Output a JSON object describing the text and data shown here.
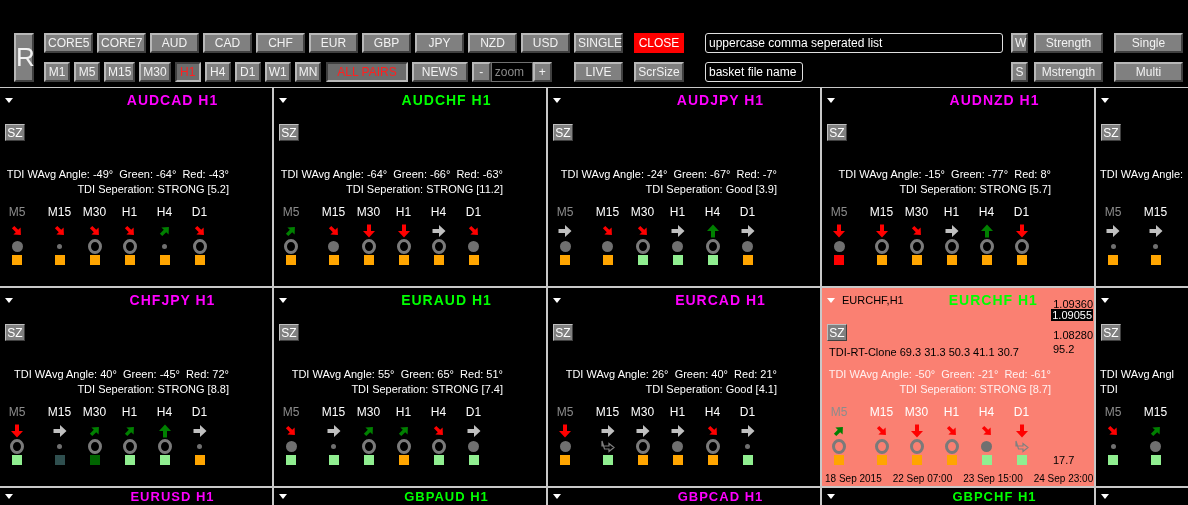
{
  "toolbar": {
    "reset": "R",
    "rows": [
      {
        "left": [
          {
            "kind": "button",
            "label": "CORE5"
          },
          {
            "kind": "button",
            "label": "CORE7"
          },
          {
            "kind": "button",
            "label": "AUD"
          },
          {
            "kind": "button",
            "label": "CAD"
          },
          {
            "kind": "button",
            "label": "CHF"
          },
          {
            "kind": "button",
            "label": "EUR"
          },
          {
            "kind": "button",
            "label": "GBP"
          },
          {
            "kind": "button",
            "label": "JPY"
          },
          {
            "kind": "button",
            "label": "NZD"
          },
          {
            "kind": "button",
            "label": "USD"
          }
        ],
        "right": [
          {
            "kind": "button",
            "label": "SINGLE"
          },
          {
            "kind": "danger",
            "label": "CLOSE"
          },
          {
            "kind": "field",
            "value": "uppercase comma seperated list"
          },
          {
            "kind": "button",
            "label": "W"
          },
          {
            "kind": "button",
            "label": "Strength"
          },
          {
            "kind": "button",
            "label": "Single"
          }
        ]
      },
      {
        "left": [
          {
            "kind": "toggle",
            "label": "M1",
            "selected": false
          },
          {
            "kind": "toggle",
            "label": "M5",
            "selected": false
          },
          {
            "kind": "toggle",
            "label": "M15",
            "selected": false
          },
          {
            "kind": "toggle",
            "label": "M30",
            "selected": false
          },
          {
            "kind": "toggle",
            "label": "H1",
            "selected": true
          },
          {
            "kind": "toggle",
            "label": "H4",
            "selected": false
          },
          {
            "kind": "toggle",
            "label": "D1",
            "selected": false
          },
          {
            "kind": "toggle",
            "label": "W1",
            "selected": false
          },
          {
            "kind": "toggle",
            "label": "MN",
            "selected": false
          },
          {
            "kind": "toggle",
            "label": "ALL PAIRS",
            "selected": true
          },
          {
            "kind": "button",
            "label": "NEWS"
          },
          {
            "kind": "button",
            "label": "-"
          },
          {
            "kind": "field",
            "placeholder": "zoom"
          },
          {
            "kind": "button",
            "label": "+"
          }
        ],
        "right": [
          {
            "kind": "button",
            "label": "LIVE"
          },
          {
            "kind": "button",
            "label": "ScrSize"
          },
          {
            "kind": "field",
            "value": "basket file name"
          },
          {
            "kind": "button",
            "label": "S"
          },
          {
            "kind": "button",
            "label": "Mstrength"
          },
          {
            "kind": "button",
            "label": "Multi"
          }
        ]
      }
    ]
  },
  "panels": [
    {
      "kind": "monitor",
      "title": "AUDCAD H1",
      "color": "#ff00ff",
      "button": "SZ",
      "lines": [
        "TDI WAvg Angle: -49°  Green: -64°  Red: -43°",
        "TDI Seperation: STRONG [5.2]"
      ],
      "columns": [
        {
          "label": "M5",
          "disabled": true,
          "arrow": {
            "kind": "down_right",
            "color": "#ff0000"
          },
          "mark": {
            "kind": "dot"
          },
          "square": {
            "color": "#ffa500"
          }
        },
        {
          "label": "M15",
          "disabled": false,
          "arrow": {
            "kind": "down_right",
            "color": "#ff0000"
          },
          "mark": {
            "kind": "small_dot"
          },
          "square": {
            "color": "#ffa500"
          }
        },
        {
          "label": "M30",
          "disabled": false,
          "arrow": {
            "kind": "down_right",
            "color": "#ff0000"
          },
          "mark": {
            "kind": "ring"
          },
          "square": {
            "color": "#ffa500"
          }
        },
        {
          "label": "H1",
          "disabled": false,
          "arrow": {
            "kind": "down_right",
            "color": "#ff0000"
          },
          "mark": {
            "kind": "ring"
          },
          "square": {
            "color": "#ffa500"
          }
        },
        {
          "label": "H4",
          "disabled": false,
          "arrow": {
            "kind": "up_right",
            "color": "#008000"
          },
          "mark": {
            "kind": "small_dot"
          },
          "square": {
            "color": "#ffa500"
          }
        },
        {
          "label": "D1",
          "disabled": false,
          "arrow": {
            "kind": "down_right",
            "color": "#ff0000"
          },
          "mark": {
            "kind": "ring"
          },
          "square": {
            "color": "#ffa500"
          }
        }
      ]
    },
    {
      "kind": "monitor",
      "title": "AUDCHF H1",
      "color": "#00ff00",
      "button": "SZ",
      "lines": [
        "TDI WAvg Angle: -64°  Green: -66°  Red: -63°",
        "TDI Seperation: STRONG [11.2]"
      ],
      "columns": [
        {
          "label": "M5",
          "disabled": true,
          "arrow": {
            "kind": "up_right",
            "color": "#008000"
          },
          "mark": {
            "kind": "ring"
          },
          "square": {
            "color": "#ffa500"
          }
        },
        {
          "label": "M15",
          "disabled": false,
          "arrow": {
            "kind": "down_right",
            "color": "#ff0000"
          },
          "mark": {
            "kind": "dot"
          },
          "square": {
            "color": "#ffa500"
          }
        },
        {
          "label": "M30",
          "disabled": false,
          "arrow": {
            "kind": "down",
            "color": "#ff0000"
          },
          "mark": {
            "kind": "ring"
          },
          "square": {
            "color": "#ffa500"
          }
        },
        {
          "label": "H1",
          "disabled": false,
          "arrow": {
            "kind": "down",
            "color": "#ff0000"
          },
          "mark": {
            "kind": "ring"
          },
          "square": {
            "color": "#ffa500"
          }
        },
        {
          "label": "H4",
          "disabled": false,
          "arrow": {
            "kind": "right",
            "color": "#c0c0c0"
          },
          "mark": {
            "kind": "ring"
          },
          "square": {
            "color": "#ffa500"
          }
        },
        {
          "label": "D1",
          "disabled": false,
          "arrow": {
            "kind": "down_right",
            "color": "#ff0000"
          },
          "mark": {
            "kind": "dot"
          },
          "square": {
            "color": "#ffa500"
          }
        }
      ]
    },
    {
      "kind": "monitor",
      "title": "AUDJPY H1",
      "color": "#ff00ff",
      "button": "SZ",
      "lines": [
        "TDI WAvg Angle: -24°  Green: -67°  Red: -7°",
        "TDI Seperation: Good [3.9]"
      ],
      "columns": [
        {
          "label": "M5",
          "disabled": true,
          "arrow": {
            "kind": "right",
            "color": "#c0c0c0"
          },
          "mark": {
            "kind": "dot"
          },
          "square": {
            "color": "#ffa500"
          }
        },
        {
          "label": "M15",
          "disabled": false,
          "arrow": {
            "kind": "down_right",
            "color": "#ff0000"
          },
          "mark": {
            "kind": "dot"
          },
          "square": {
            "color": "#ffa500"
          }
        },
        {
          "label": "M30",
          "disabled": false,
          "arrow": {
            "kind": "down_right",
            "color": "#ff0000"
          },
          "mark": {
            "kind": "ring"
          },
          "square": {
            "color": "#90ee90"
          }
        },
        {
          "label": "H1",
          "disabled": false,
          "arrow": {
            "kind": "right",
            "color": "#c0c0c0"
          },
          "mark": {
            "kind": "dot"
          },
          "square": {
            "color": "#90ee90"
          }
        },
        {
          "label": "H4",
          "disabled": false,
          "arrow": {
            "kind": "up",
            "color": "#008000"
          },
          "mark": {
            "kind": "ring"
          },
          "square": {
            "color": "#90ee90"
          }
        },
        {
          "label": "D1",
          "disabled": false,
          "arrow": {
            "kind": "right",
            "color": "#c0c0c0"
          },
          "mark": {
            "kind": "dot"
          },
          "square": {
            "color": "#ffa500"
          }
        }
      ]
    },
    {
      "kind": "monitor",
      "title": "AUDNZD H1",
      "color": "#ff00ff",
      "button": "SZ",
      "lines": [
        "TDI WAvg Angle: -15°  Green: -77°  Red: 8°",
        "TDI Seperation: STRONG [5.7]"
      ],
      "columns": [
        {
          "label": "M5",
          "disabled": true,
          "arrow": {
            "kind": "down",
            "color": "#ff0000"
          },
          "mark": {
            "kind": "dot"
          },
          "square": {
            "color": "#ff0000"
          }
        },
        {
          "label": "M15",
          "disabled": false,
          "arrow": {
            "kind": "down",
            "color": "#ff0000"
          },
          "mark": {
            "kind": "ring"
          },
          "square": {
            "color": "#ffa500"
          }
        },
        {
          "label": "M30",
          "disabled": false,
          "arrow": {
            "kind": "down_right",
            "color": "#ff0000"
          },
          "mark": {
            "kind": "ring"
          },
          "square": {
            "color": "#ffa500"
          }
        },
        {
          "label": "H1",
          "disabled": false,
          "arrow": {
            "kind": "right",
            "color": "#c0c0c0"
          },
          "mark": {
            "kind": "ring"
          },
          "square": {
            "color": "#ffa500"
          }
        },
        {
          "label": "H4",
          "disabled": false,
          "arrow": {
            "kind": "up",
            "color": "#008000"
          },
          "mark": {
            "kind": "ring"
          },
          "square": {
            "color": "#ffa500"
          }
        },
        {
          "label": "D1",
          "disabled": false,
          "arrow": {
            "kind": "down",
            "color": "#ff0000"
          },
          "mark": {
            "kind": "ring"
          },
          "square": {
            "color": "#ffa500"
          }
        }
      ]
    },
    {
      "kind": "partial",
      "button": "SZ",
      "lines": [
        "TDI WAvg Angle:"
      ],
      "columns": [
        {
          "label": "M5",
          "disabled": true,
          "arrow": {
            "kind": "right",
            "color": "#c0c0c0"
          },
          "mark": {
            "kind": "small_dot"
          },
          "square": {
            "color": "#ffa500"
          }
        },
        {
          "label": "M15",
          "disabled": false,
          "arrow": {
            "kind": "right",
            "color": "#c0c0c0"
          },
          "mark": {
            "kind": "small_dot"
          },
          "square": {
            "color": "#ffa500"
          }
        }
      ]
    },
    {
      "kind": "monitor",
      "title": "CHFJPY H1",
      "color": "#ff00ff",
      "button": "SZ",
      "lines": [
        "TDI WAvg Angle: 40°  Green: -45°  Red: 72°",
        "TDI Seperation: STRONG [8.8]"
      ],
      "columns": [
        {
          "label": "M5",
          "disabled": true,
          "arrow": {
            "kind": "down",
            "color": "#ff0000"
          },
          "mark": {
            "kind": "ring"
          },
          "square": {
            "color": "#90ee90"
          }
        },
        {
          "label": "M15",
          "disabled": false,
          "arrow": {
            "kind": "right",
            "color": "#c0c0c0"
          },
          "mark": {
            "kind": "small_dot"
          },
          "square": {
            "color": "#2f4f4f"
          }
        },
        {
          "label": "M30",
          "disabled": false,
          "arrow": {
            "kind": "up_right",
            "color": "#008000"
          },
          "mark": {
            "kind": "ring"
          },
          "square": {
            "color": "#006400"
          }
        },
        {
          "label": "H1",
          "disabled": false,
          "arrow": {
            "kind": "up_right",
            "color": "#008000"
          },
          "mark": {
            "kind": "ring"
          },
          "square": {
            "color": "#90ee90"
          }
        },
        {
          "label": "H4",
          "disabled": false,
          "arrow": {
            "kind": "up",
            "color": "#008000"
          },
          "mark": {
            "kind": "ring"
          },
          "square": {
            "color": "#90ee90"
          }
        },
        {
          "label": "D1",
          "disabled": false,
          "arrow": {
            "kind": "right",
            "color": "#c0c0c0"
          },
          "mark": {
            "kind": "small_dot"
          },
          "square": {
            "color": "#ffa500"
          }
        }
      ]
    },
    {
      "kind": "monitor",
      "title": "EURAUD H1",
      "color": "#00ff00",
      "button": "SZ",
      "lines": [
        "TDI WAvg Angle: 55°  Green: 65°  Red: 51°",
        "TDI Seperation: STRONG [7.4]"
      ],
      "columns": [
        {
          "label": "M5",
          "disabled": true,
          "arrow": {
            "kind": "down_right",
            "color": "#ff0000"
          },
          "mark": {
            "kind": "dot"
          },
          "square": {
            "color": "#90ee90"
          }
        },
        {
          "label": "M15",
          "disabled": false,
          "arrow": {
            "kind": "right",
            "color": "#c0c0c0"
          },
          "mark": {
            "kind": "small_dot"
          },
          "square": {
            "color": "#90ee90"
          }
        },
        {
          "label": "M30",
          "disabled": false,
          "arrow": {
            "kind": "up_right",
            "color": "#008000"
          },
          "mark": {
            "kind": "ring"
          },
          "square": {
            "color": "#90ee90"
          }
        },
        {
          "label": "H1",
          "disabled": false,
          "arrow": {
            "kind": "up_right",
            "color": "#008000"
          },
          "mark": {
            "kind": "ring"
          },
          "square": {
            "color": "#ffa500"
          }
        },
        {
          "label": "H4",
          "disabled": false,
          "arrow": {
            "kind": "down_right",
            "color": "#ff0000"
          },
          "mark": {
            "kind": "ring"
          },
          "square": {
            "color": "#90ee90"
          }
        },
        {
          "label": "D1",
          "disabled": false,
          "arrow": {
            "kind": "right",
            "color": "#c0c0c0"
          },
          "mark": {
            "kind": "dot"
          },
          "square": {
            "color": "#90ee90"
          }
        }
      ]
    },
    {
      "kind": "monitor",
      "title": "EURCAD H1",
      "color": "#ff00ff",
      "button": "SZ",
      "lines": [
        "TDI WAvg Angle: 26°  Green: 40°  Red: 21°",
        "TDI Seperation: Good [4.1]"
      ],
      "columns": [
        {
          "label": "M5",
          "disabled": true,
          "arrow": {
            "kind": "down",
            "color": "#ff0000"
          },
          "mark": {
            "kind": "dot"
          },
          "square": {
            "color": "#ffa500"
          }
        },
        {
          "label": "M15",
          "disabled": false,
          "arrow": {
            "kind": "right",
            "color": "#c0c0c0"
          },
          "mark": {
            "kind": "hook"
          },
          "square": {
            "color": "#90ee90"
          }
        },
        {
          "label": "M30",
          "disabled": false,
          "arrow": {
            "kind": "right",
            "color": "#c0c0c0"
          },
          "mark": {
            "kind": "ring"
          },
          "square": {
            "color": "#ffa500"
          }
        },
        {
          "label": "H1",
          "disabled": false,
          "arrow": {
            "kind": "right",
            "color": "#c0c0c0"
          },
          "mark": {
            "kind": "dot"
          },
          "square": {
            "color": "#ffa500"
          }
        },
        {
          "label": "H4",
          "disabled": false,
          "arrow": {
            "kind": "down_right",
            "color": "#ff0000"
          },
          "mark": {
            "kind": "ring"
          },
          "square": {
            "color": "#ffa500"
          }
        },
        {
          "label": "D1",
          "disabled": false,
          "arrow": {
            "kind": "right",
            "color": "#c0c0c0"
          },
          "mark": {
            "kind": "small_dot"
          },
          "square": {
            "color": "#90ee90"
          }
        }
      ]
    },
    {
      "kind": "chart",
      "symbol": "EURCHF,H1",
      "title": "EURCHF H1",
      "color": "#00ff00",
      "button": "SZ",
      "price_high": "1.09360",
      "price_current": "1.09055",
      "price_low": "1.08280",
      "indicator": "TDI-RT-Clone 69.3 31.3 50.3 41.1 30.7",
      "indicator_high": "95.2",
      "indicator_low": "17.7",
      "dates": [
        "18 Sep 2015",
        "22 Sep 07:00",
        "23 Sep 15:00",
        "24 Sep 23:00"
      ],
      "lines": [
        "TDI WAvg Angle: -50°  Green: -21°  Red: -61°",
        "TDI Seperation: STRONG [8.7]"
      ],
      "columns": [
        {
          "label": "M5",
          "disabled": true,
          "arrow": {
            "kind": "up_right",
            "color": "#008000"
          },
          "mark": {
            "kind": "ring"
          },
          "square": {
            "color": "#ffa500"
          }
        },
        {
          "label": "M15",
          "disabled": false,
          "arrow": {
            "kind": "down_right",
            "color": "#ff0000"
          },
          "mark": {
            "kind": "ring"
          },
          "square": {
            "color": "#ffa500"
          }
        },
        {
          "label": "M30",
          "disabled": false,
          "arrow": {
            "kind": "down",
            "color": "#ff0000"
          },
          "mark": {
            "kind": "ring"
          },
          "square": {
            "color": "#ffa500"
          }
        },
        {
          "label": "H1",
          "disabled": false,
          "arrow": {
            "kind": "down_right",
            "color": "#ff0000"
          },
          "mark": {
            "kind": "ring"
          },
          "square": {
            "color": "#ffa500"
          }
        },
        {
          "label": "H4",
          "disabled": false,
          "arrow": {
            "kind": "down_right",
            "color": "#ff0000"
          },
          "mark": {
            "kind": "dot"
          },
          "square": {
            "color": "#90ee90"
          }
        },
        {
          "label": "D1",
          "disabled": false,
          "arrow": {
            "kind": "down",
            "color": "#ff0000"
          },
          "mark": {
            "kind": "hook"
          },
          "square": {
            "color": "#90ee90"
          }
        }
      ]
    },
    {
      "kind": "partial",
      "button": "SZ",
      "lines": [
        "TDI WAvg Angl",
        "TDI"
      ],
      "columns": [
        {
          "label": "M5",
          "disabled": true,
          "arrow": {
            "kind": "down_right",
            "color": "#ff0000"
          },
          "mark": {
            "kind": "small_dot"
          },
          "square": {
            "color": "#90ee90"
          }
        },
        {
          "label": "M15",
          "disabled": false,
          "arrow": {
            "kind": "up_right",
            "color": "#008000"
          },
          "mark": {
            "kind": "dot"
          },
          "square": {
            "color": "#90ee90"
          }
        }
      ]
    },
    {
      "kind": "header",
      "title": "EURUSD H1",
      "color": "#ff00ff"
    },
    {
      "kind": "header",
      "title": "GBPAUD H1",
      "color": "#00ff00"
    },
    {
      "kind": "header",
      "title": "GBPCAD H1",
      "color": "#ff00ff"
    },
    {
      "kind": "header",
      "title": "GBPCHF H1",
      "color": "#00ff00"
    },
    {
      "kind": "header"
    }
  ]
}
